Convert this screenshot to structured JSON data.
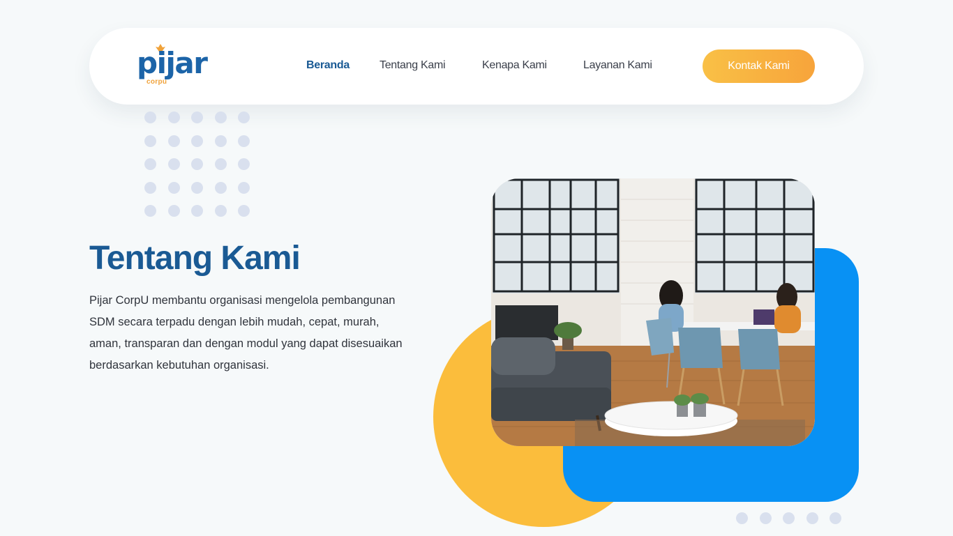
{
  "brand": {
    "name": "pijar",
    "sub": "corpu"
  },
  "nav": {
    "items": [
      {
        "label": "Beranda",
        "active": true
      },
      {
        "label": "Tentang Kami",
        "active": false
      },
      {
        "label": "Kenapa Kami",
        "active": false
      },
      {
        "label": "Layanan Kami",
        "active": false
      }
    ],
    "cta": "Kontak Kami"
  },
  "hero": {
    "title": "Tentang Kami",
    "description": "Pijar CorpU membantu organisasi mengelola pembangunan SDM secara terpadu dengan lebih mudah, cepat, murah, aman, transparan dan dengan modul yang dapat disesuaikan berdasarkan kebutuhan organisasi."
  },
  "colors": {
    "primary": "#1a5a94",
    "accent_yellow": "#fbbd3c",
    "accent_blue": "#0891f4",
    "cta_start": "#f9c046",
    "cta_end": "#f7a43b",
    "dot": "#d9e0ee"
  },
  "icons": {
    "logo_flame": "flame-icon"
  }
}
